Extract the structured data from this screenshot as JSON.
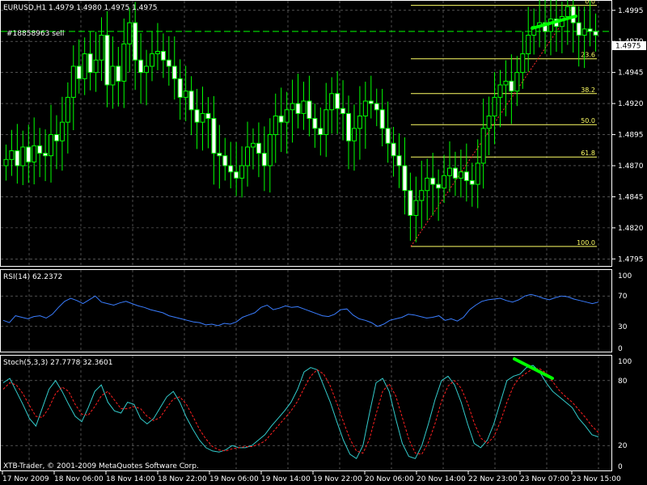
{
  "main_header": "EURUSD,H1  1.4979 1.4980 1.4975 1.4975",
  "order_label": "#18858963 sell",
  "copyright": "XTB-Trader, © 2001-2009 MetaQuotes Software Corp.",
  "colors": {
    "background": "#000000",
    "grid": "#7f7f7f",
    "candle": "#00ff00",
    "candle_body_bull": "#000000",
    "candle_body_bear": "#ffffff",
    "fib": "#ffff66",
    "rsi_line": "#3a7dff",
    "stoch_main": "#33cccc",
    "stoch_signal": "#ff2020",
    "trendline": "#00ff00",
    "current_price_box": "#ffffff",
    "order_line": "#00ff00"
  },
  "chart_data": [
    {
      "type": "candlestick",
      "name": "EURUSD,H1",
      "current_price": "1.4975",
      "y_ticks": [
        "1.4995",
        "1.4970",
        "1.4945",
        "1.4920",
        "1.4895",
        "1.4870",
        "1.4845",
        "1.4820",
        "1.4795"
      ],
      "ylim": [
        1.479,
        1.5002
      ],
      "x_ticks": [
        "17 Nov 2009",
        "18 Nov 06:00",
        "18 Nov 14:00",
        "18 Nov 22:00",
        "19 Nov 06:00",
        "19 Nov 14:00",
        "19 Nov 22:00",
        "20 Nov 06:00",
        "20 Nov 14:00",
        "22 Nov 23:00",
        "23 Nov 07:00",
        "23 Nov 15:00"
      ],
      "order_price": 1.4978,
      "fibonacci": {
        "levels": [
          {
            "label": "0.0",
            "price": 1.4999
          },
          {
            "label": "23.6",
            "price": 1.4956
          },
          {
            "label": "38.2",
            "price": 1.4928
          },
          {
            "label": "50.0",
            "price": 1.4903
          },
          {
            "label": "61.8",
            "price": 1.4877
          },
          {
            "label": "100.0",
            "price": 1.4805
          }
        ]
      },
      "candles_close": [
        1.4875,
        1.4882,
        1.487,
        1.4885,
        1.4873,
        1.4886,
        1.488,
        1.4878,
        1.4895,
        1.489,
        1.4905,
        1.4925,
        1.495,
        1.494,
        1.496,
        1.4945,
        1.4955,
        1.4975,
        1.4935,
        1.495,
        1.4938,
        1.4968,
        1.4985,
        1.4955,
        1.4945,
        1.495,
        1.496,
        1.4962,
        1.4955,
        1.495,
        1.494,
        1.4925,
        1.493,
        1.4915,
        1.4905,
        1.4912,
        1.4908,
        1.488,
        1.4878,
        1.487,
        1.4865,
        1.486,
        1.487,
        1.4885,
        1.4888,
        1.488,
        1.487,
        1.4895,
        1.491,
        1.4905,
        1.4915,
        1.492,
        1.4912,
        1.4922,
        1.4908,
        1.49,
        1.4895,
        1.4915,
        1.4928,
        1.4916,
        1.4912,
        1.489,
        1.49,
        1.491,
        1.4922,
        1.492,
        1.4915,
        1.49,
        1.4888,
        1.4878,
        1.487,
        1.485,
        1.483,
        1.4842,
        1.485,
        1.486,
        1.4855,
        1.4852,
        1.4862,
        1.4868,
        1.486,
        1.4865,
        1.4858,
        1.4855,
        1.4872,
        1.49,
        1.491,
        1.4925,
        1.4935,
        1.4938,
        1.493,
        1.4945,
        1.496,
        1.4975,
        1.4982,
        1.4985,
        1.4978,
        1.4988,
        1.4982,
        1.499,
        1.4998,
        1.4985,
        1.4975,
        1.498,
        1.4978,
        1.4975
      ]
    },
    {
      "type": "line",
      "name": "RSI(14) 62.2372",
      "y_ticks": [
        "100",
        "70",
        "30",
        "0"
      ],
      "ylim": [
        0,
        100
      ],
      "values": [
        38,
        35,
        44,
        42,
        40,
        43,
        44,
        41,
        46,
        55,
        63,
        67,
        64,
        60,
        65,
        70,
        62,
        60,
        58,
        61,
        63,
        60,
        57,
        55,
        52,
        50,
        48,
        44,
        42,
        40,
        38,
        36,
        35,
        32,
        33,
        31,
        34,
        33,
        36,
        42,
        45,
        48,
        55,
        58,
        52,
        54,
        57,
        55,
        56,
        53,
        50,
        47,
        44,
        43,
        46,
        52,
        53,
        45,
        40,
        38,
        35,
        30,
        33,
        38,
        40,
        42,
        46,
        45,
        43,
        41,
        42,
        44,
        38,
        40,
        37,
        42,
        52,
        58,
        63,
        65,
        66,
        67,
        64,
        62,
        65,
        70,
        72,
        70,
        67,
        65,
        68,
        70,
        69,
        66,
        64,
        62,
        60,
        62
      ]
    },
    {
      "type": "line",
      "name": "Stoch(5,3,3) 27.7778 32.3601",
      "y_ticks": [
        "100",
        "80",
        "20",
        "0"
      ],
      "ylim": [
        0,
        100
      ],
      "series": [
        {
          "values": [
            78,
            82,
            70,
            58,
            45,
            38,
            55,
            72,
            80,
            70,
            58,
            47,
            42,
            55,
            70,
            76,
            60,
            52,
            50,
            60,
            58,
            45,
            40,
            45,
            55,
            65,
            70,
            60,
            46,
            35,
            25,
            18,
            15,
            14,
            16,
            20,
            18,
            18,
            20,
            25,
            30,
            38,
            45,
            52,
            60,
            72,
            88,
            92,
            90,
            75,
            60,
            42,
            25,
            12,
            8,
            20,
            50,
            78,
            82,
            70,
            45,
            22,
            10,
            8,
            20,
            40,
            62,
            80,
            84,
            76,
            60,
            40,
            22,
            18,
            25,
            40,
            60,
            80,
            84,
            86,
            92,
            94,
            88,
            78,
            70,
            65,
            60,
            55,
            45,
            38,
            30,
            28
          ]
        },
        {
          "values": [
            72,
            78,
            76,
            68,
            57,
            47,
            46,
            55,
            68,
            74,
            70,
            58,
            49,
            48,
            56,
            66,
            70,
            62,
            54,
            54,
            56,
            54,
            47,
            43,
            46,
            55,
            63,
            65,
            58,
            47,
            35,
            26,
            19,
            16,
            15,
            17,
            18,
            19,
            19,
            21,
            24,
            31,
            38,
            45,
            52,
            61,
            73,
            84,
            90,
            86,
            75,
            59,
            42,
            26,
            15,
            13,
            26,
            49,
            70,
            77,
            66,
            46,
            26,
            13,
            12,
            23,
            40,
            61,
            75,
            80,
            73,
            59,
            41,
            27,
            22,
            28,
            42,
            60,
            75,
            83,
            87,
            91,
            91,
            87,
            79,
            71,
            65,
            60,
            53,
            46,
            38,
            32
          ]
        }
      ]
    }
  ]
}
